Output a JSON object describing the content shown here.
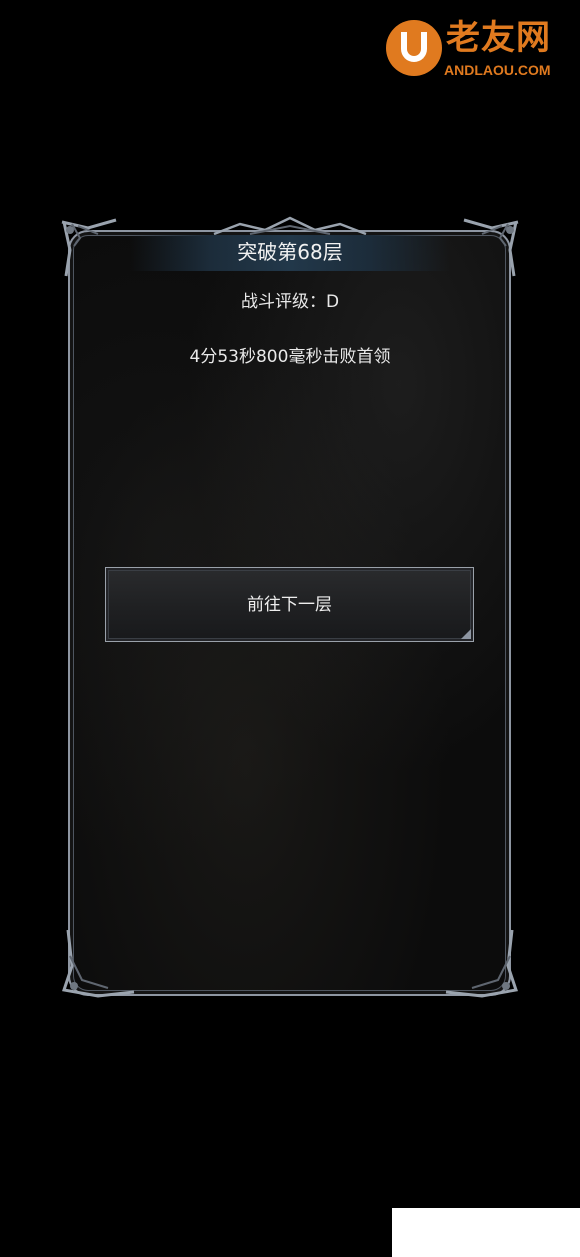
{
  "watermark": {
    "title": "老友网",
    "subtitle": "ANDLAOU.COM",
    "color": "#e07a1f"
  },
  "dialog": {
    "title": "突破第68层",
    "grade": "战斗评级：D",
    "kill_time": "4分53秒800毫秒击败首领",
    "next_button_label": "前往下一层"
  },
  "colors": {
    "background": "#000000",
    "panel_border": "#8e96a2",
    "header_band": "#22384a",
    "text": "#f2f2f2"
  }
}
